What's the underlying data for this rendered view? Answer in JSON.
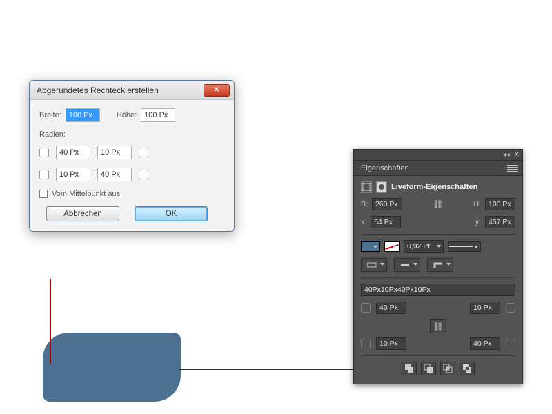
{
  "dialog": {
    "title": "Abgerundetes Rechteck erstellen",
    "width_label": "Breite:",
    "width_value": "100 Px",
    "height_label": "Höhe:",
    "height_value": "100 Px",
    "radii_label": "Radien:",
    "radius_tl": "40 Px",
    "radius_tr": "10 Px",
    "radius_bl": "10 Px",
    "radius_br": "40 Px",
    "from_center_label": "Vom Mittelpunkt aus",
    "cancel": "Abbrechen",
    "ok": "OK"
  },
  "panel": {
    "tab_title": "Eigenschaften",
    "header": "Liveform-Eigenschaften",
    "B_label": "B:",
    "B_value": "260 Px",
    "H_label": "H:",
    "H_value": "100 Px",
    "x_label": "x:",
    "x_value": "54 Px",
    "y_label": "y:",
    "y_value": "457 Px",
    "stroke_weight": "0,92 Pt",
    "radii_summary": "40Px10Px40Px10Px",
    "radius_tl": "40 Px",
    "radius_tr": "10 Px",
    "radius_bl": "10 Px",
    "radius_br": "40 Px",
    "collapse": "◂◂",
    "close": "✕"
  }
}
